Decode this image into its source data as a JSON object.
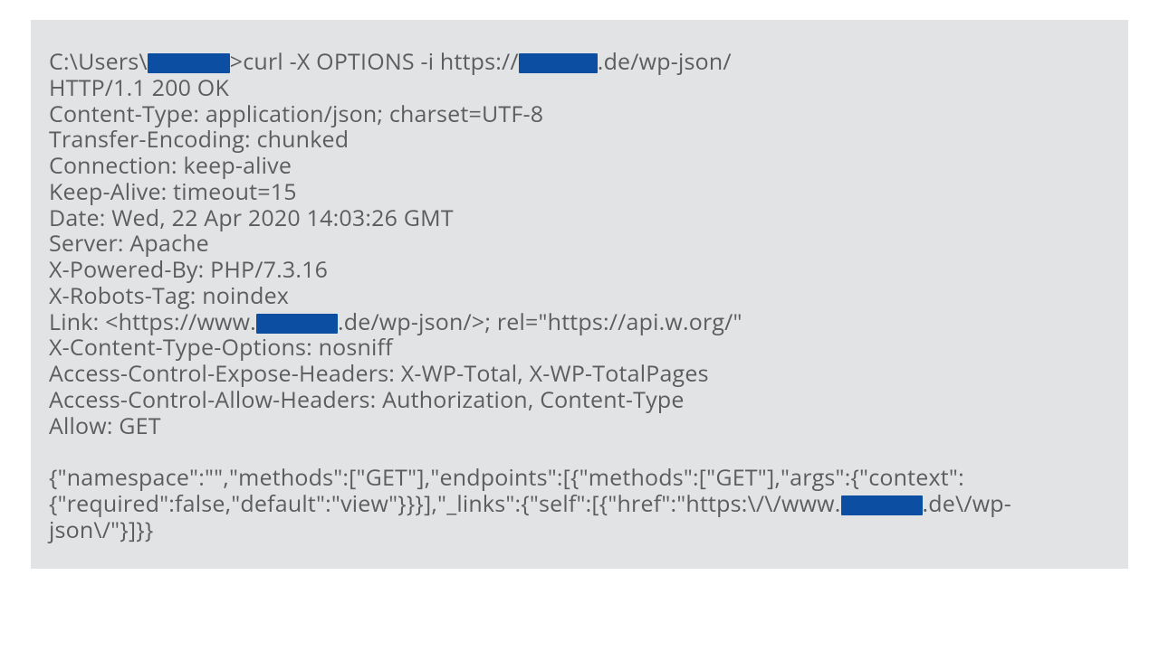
{
  "terminal": {
    "prompt_pre": "C:\\Users\\",
    "prompt_post": ">curl  -X OPTIONS -i https://",
    "prompt_domain_suffix": ".de/wp-json/",
    "h_status": "HTTP/1.1 200 OK",
    "h_ctype": "Content-Type: application/json; charset=UTF-8",
    "h_te": "Transfer-Encoding: chunked",
    "h_conn": "Connection: keep-alive",
    "h_ka": "Keep-Alive: timeout=15",
    "h_date": "Date: Wed, 22 Apr 2020 14:03:26 GMT",
    "h_server": "Server: Apache",
    "h_xpb": "X-Powered-By: PHP/7.3.16",
    "h_xrobots": "X-Robots-Tag: noindex",
    "link_pre": "Link: <https://www.",
    "link_post": ".de/wp-json/>; rel=\"https://api.w.org/\"",
    "h_xcto": "X-Content-Type-Options: nosniff",
    "h_ac_expose": "Access-Control-Expose-Headers:  X-WP-Total, X-WP-TotalPages",
    "h_ac_allow": "Access-Control-Allow-Headers:  Authorization, Content-Type",
    "h_allow": "Allow: GET",
    "body_pre": "{\"namespace\":\"\",\"methods\":[\"GET\"],\"endpoints\":[{\"methods\":[\"GET\"],\"args\":{\"context\":{\"required\":false,\"default\":\"view\"}}}],\"_links\":{\"self\":[{\"href\":\"https:\\/\\/www.",
    "body_post": ".de\\/wp-json\\/\"}]}}"
  }
}
